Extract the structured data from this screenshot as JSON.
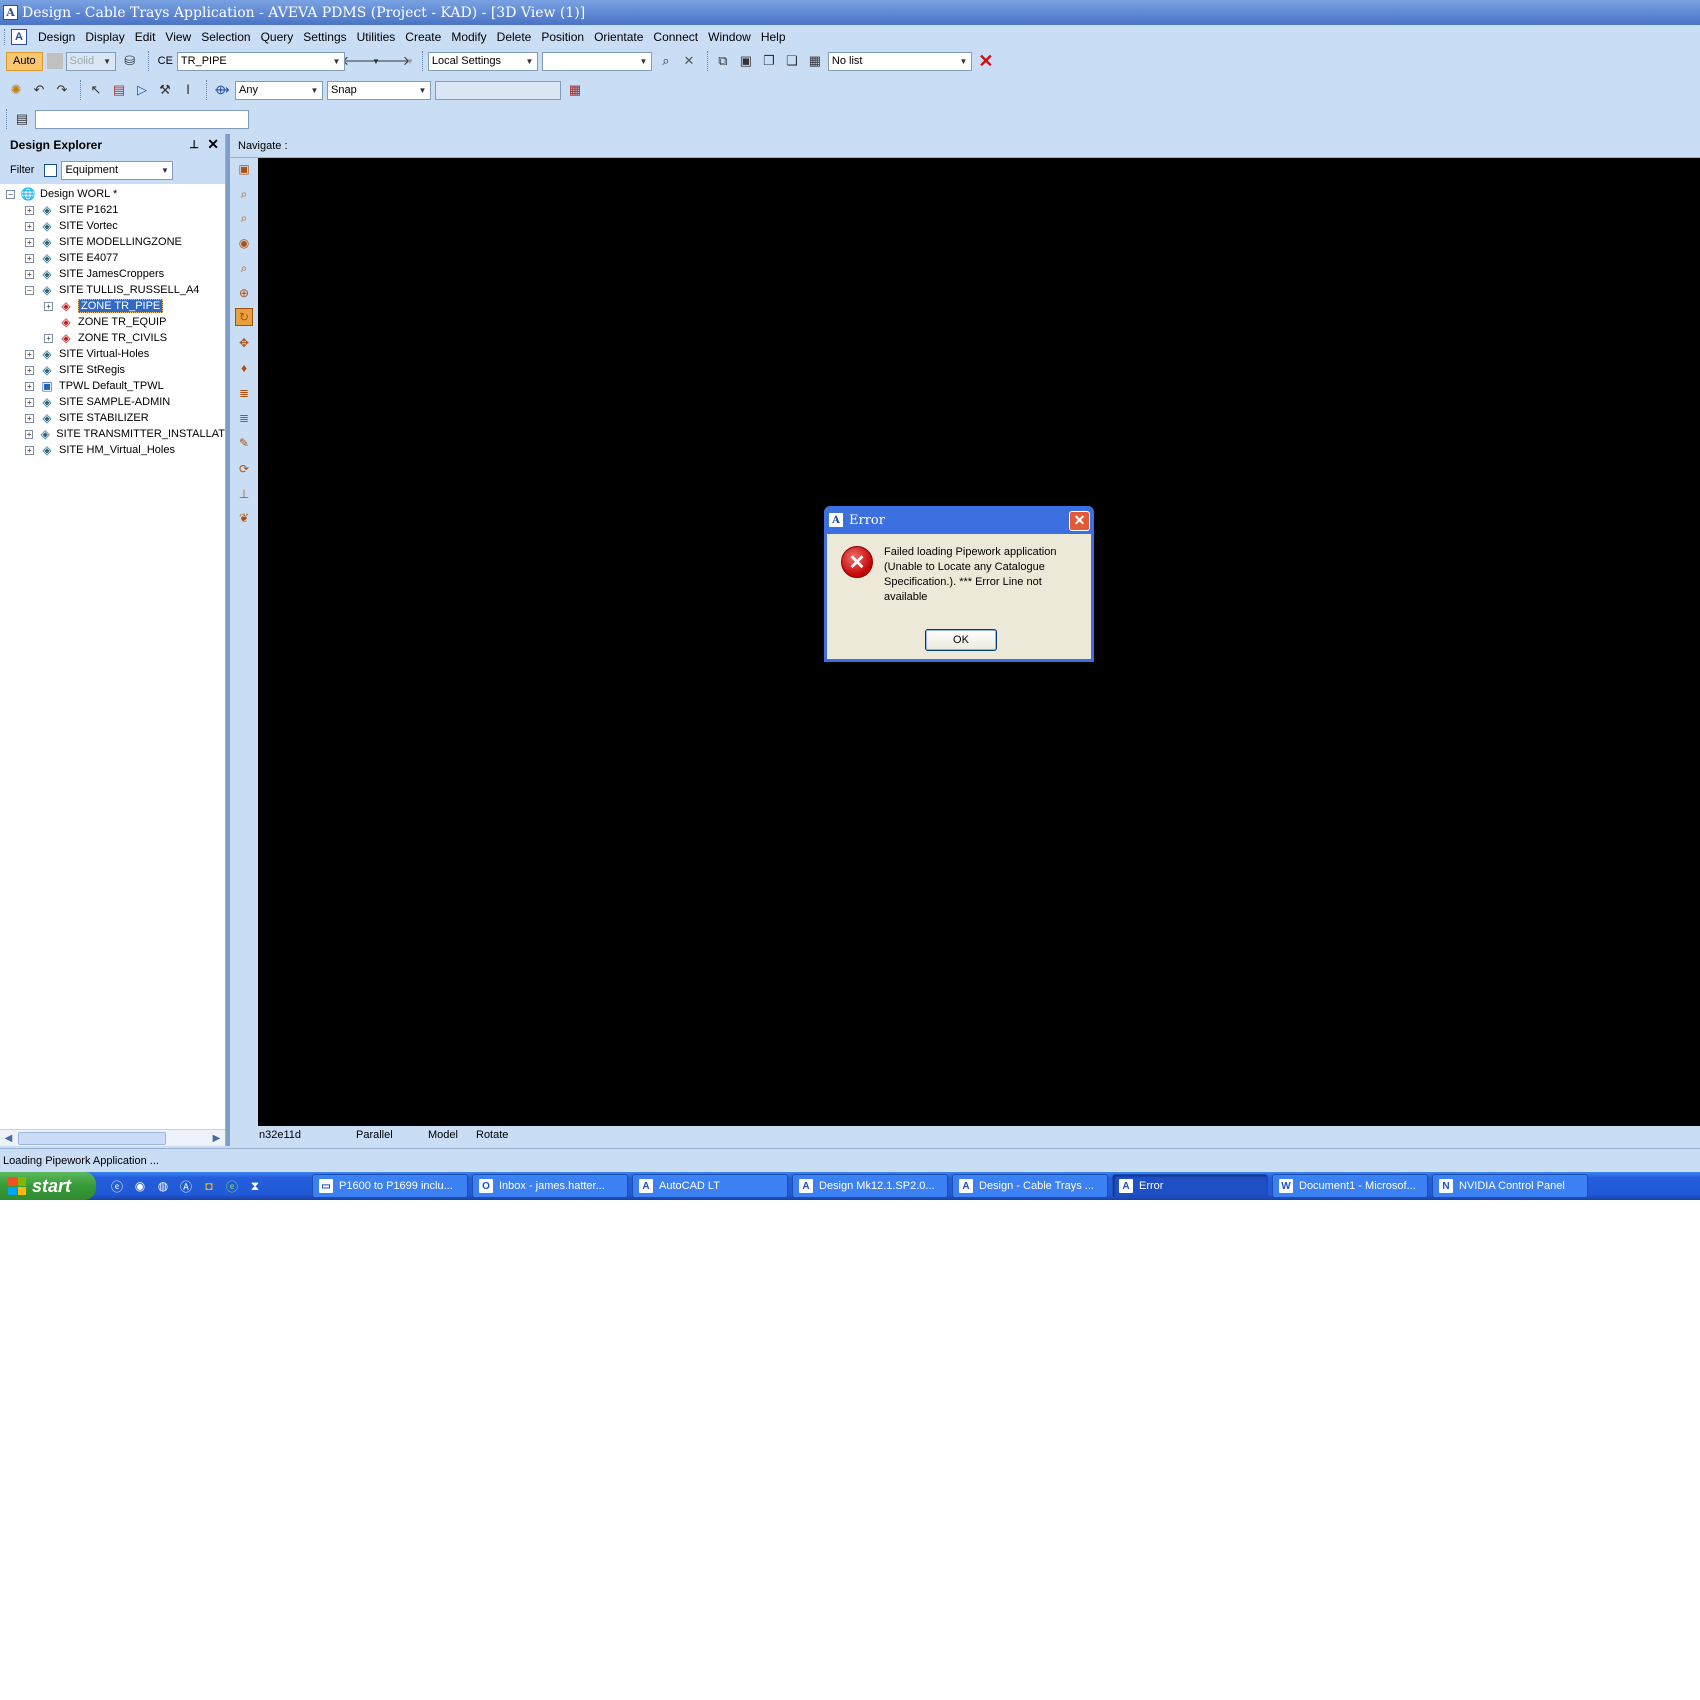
{
  "window": {
    "title": "Design - Cable Trays Application -  AVEVA PDMS (Project - KAD) - [3D View (1)]"
  },
  "menu": {
    "items": [
      "Design",
      "Display",
      "Edit",
      "View",
      "Selection",
      "Query",
      "Settings",
      "Utilities",
      "Create",
      "Modify",
      "Delete",
      "Position",
      "Orientate",
      "Connect",
      "Window",
      "Help"
    ]
  },
  "toolbar1": {
    "auto_label": "Auto",
    "render_mode": "Solid",
    "ce_label": "CE",
    "ce_value": "TR_PIPE",
    "settings_value": "Local Settings",
    "list_value": "No list"
  },
  "toolbar2": {
    "filter_value": "Any",
    "snap_value": "Snap"
  },
  "explorer": {
    "title": "Design Explorer",
    "filter_label": "Filter",
    "filter_value": "Equipment",
    "tree": [
      {
        "label": "Design WORL *",
        "level": 0,
        "expander": "-",
        "icon": "world"
      },
      {
        "label": "SITE P1621",
        "level": 1,
        "expander": "+",
        "icon": "site"
      },
      {
        "label": "SITE Vortec",
        "level": 1,
        "expander": "+",
        "icon": "site"
      },
      {
        "label": "SITE MODELLINGZONE",
        "level": 1,
        "expander": "+",
        "icon": "site"
      },
      {
        "label": "SITE E4077",
        "level": 1,
        "expander": "+",
        "icon": "site"
      },
      {
        "label": "SITE JamesCroppers",
        "level": 1,
        "expander": "+",
        "icon": "site"
      },
      {
        "label": "SITE TULLIS_RUSSELL_A4",
        "level": 1,
        "expander": "-",
        "icon": "site"
      },
      {
        "label": "ZONE TR_PIPE",
        "level": 2,
        "expander": "+",
        "icon": "zone",
        "selected": true
      },
      {
        "label": "ZONE TR_EQUIP",
        "level": 2,
        "expander": "",
        "icon": "zone"
      },
      {
        "label": "ZONE TR_CIVILS",
        "level": 2,
        "expander": "+",
        "icon": "zone"
      },
      {
        "label": "SITE Virtual-Holes",
        "level": 1,
        "expander": "+",
        "icon": "site"
      },
      {
        "label": "SITE StRegis",
        "level": 1,
        "expander": "+",
        "icon": "site"
      },
      {
        "label": "TPWL Default_TPWL",
        "level": 1,
        "expander": "+",
        "icon": "tpwl"
      },
      {
        "label": "SITE SAMPLE-ADMIN",
        "level": 1,
        "expander": "+",
        "icon": "site"
      },
      {
        "label": "SITE STABILIZER",
        "level": 1,
        "expander": "+",
        "icon": "site"
      },
      {
        "label": "SITE TRANSMITTER_INSTALLAT",
        "level": 1,
        "expander": "+",
        "icon": "site"
      },
      {
        "label": "SITE HM_Virtual_Holes",
        "level": 1,
        "expander": "+",
        "icon": "site"
      }
    ]
  },
  "view": {
    "navigate_label": "Navigate :",
    "status": {
      "name": "n32e11d",
      "projection": "Parallel",
      "mode": "Model",
      "action": "Rotate"
    }
  },
  "statusbar": {
    "text": "Loading Pipework Application ..."
  },
  "dialog": {
    "title": "Error",
    "message": "Failed loading Pipework application (Unable to Locate any Catalogue Specification.).  *** Error Line not available",
    "ok_label": "OK"
  },
  "taskbar": {
    "start_label": "start",
    "tasks": [
      {
        "label": "P1600 to P1699 inclu...",
        "icon": "folder"
      },
      {
        "label": "Inbox - james.hatter...",
        "icon": "outlook"
      },
      {
        "label": "AutoCAD LT",
        "icon": "autocad"
      },
      {
        "label": "Design Mk12.1.SP2.0...",
        "icon": "aveva"
      },
      {
        "label": "Design - Cable Trays ...",
        "icon": "aveva"
      },
      {
        "label": "Error",
        "icon": "aveva",
        "active": true
      },
      {
        "label": "Document1 - Microsof...",
        "icon": "word"
      },
      {
        "label": "NVIDIA Control Panel",
        "icon": "nvidia"
      }
    ]
  },
  "colors": {
    "chrome": "#c9ddf5",
    "viewport": "#000000",
    "selection": "#316ac5",
    "taskbar": "#245edb",
    "start": "#379a37",
    "error": "#c40000"
  }
}
